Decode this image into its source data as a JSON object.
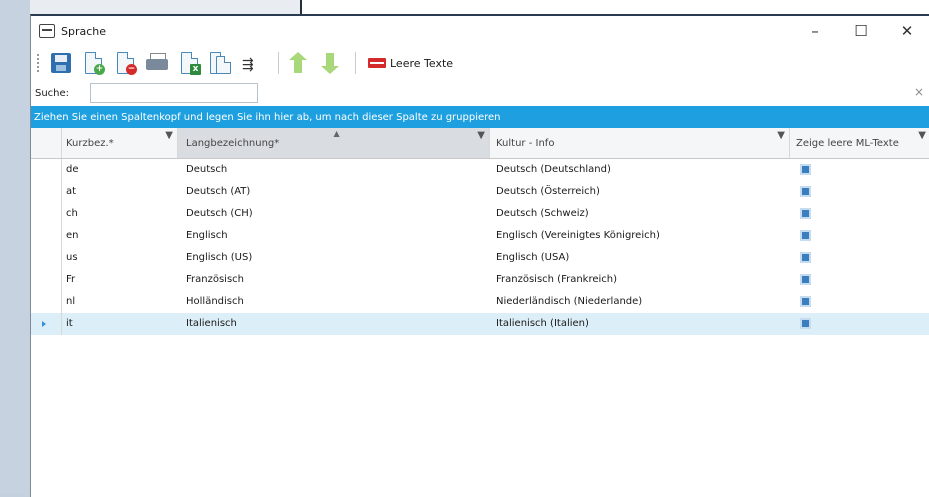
{
  "window": {
    "title": "Sprache",
    "controls": {
      "minimize": "–",
      "maximize": "☐",
      "close": "✕"
    }
  },
  "toolbar": {
    "buttons": [
      {
        "name": "save-button",
        "icon": "floppy-disk-icon"
      },
      {
        "name": "new-button",
        "icon": "document-add-icon"
      },
      {
        "name": "delete-button",
        "icon": "document-remove-icon"
      },
      {
        "name": "print-button",
        "icon": "printer-icon"
      },
      {
        "name": "export-excel-button",
        "icon": "excel-export-icon"
      },
      {
        "name": "copy-button",
        "icon": "copy-documents-icon"
      },
      {
        "name": "merge-button",
        "icon": "merge-arrow-icon"
      },
      {
        "name": "move-up-button",
        "icon": "arrow-up-icon"
      },
      {
        "name": "move-down-button",
        "icon": "arrow-down-icon"
      }
    ],
    "leere_texte_label": "Leere Texte"
  },
  "search": {
    "label": "Suche:",
    "value": "",
    "placeholder": "",
    "clear": "×"
  },
  "group_panel": {
    "text": "Ziehen Sie einen Spaltenkopf und legen Sie ihn hier ab, um nach dieser Spalte zu gruppieren"
  },
  "grid": {
    "columns": [
      "Kurzbez.*",
      "Langbezeichnung*",
      "Kultur - Info",
      "Zeige leere ML-Texte"
    ],
    "sort_indicator": "▲",
    "filter_indicator": "▼",
    "rows": [
      {
        "code": "de",
        "name": "Deutsch",
        "culture": "Deutsch (Deutschland)",
        "show_empty": true
      },
      {
        "code": "at",
        "name": "Deutsch (AT)",
        "culture": "Deutsch (Österreich)",
        "show_empty": true
      },
      {
        "code": "ch",
        "name": "Deutsch (CH)",
        "culture": "Deutsch (Schweiz)",
        "show_empty": true
      },
      {
        "code": "en",
        "name": "Englisch",
        "culture": "Englisch (Vereinigtes Königreich)",
        "show_empty": true
      },
      {
        "code": "us",
        "name": "Englisch (US)",
        "culture": "Englisch (USA)",
        "show_empty": true
      },
      {
        "code": "Fr",
        "name": "Französisch",
        "culture": "Französisch (Frankreich)",
        "show_empty": true
      },
      {
        "code": "nl",
        "name": "Holländisch",
        "culture": "Niederländisch (Niederlande)",
        "show_empty": true
      },
      {
        "code": "it",
        "name": "Italienisch",
        "culture": "Italienisch (Italien)",
        "show_empty": true
      }
    ],
    "selected_row": 7
  },
  "colors": {
    "accent": "#1ea0e0",
    "selected_row": "#dceef8",
    "delete_red": "#d42a2a",
    "arrow_green": "#a8d87a"
  }
}
